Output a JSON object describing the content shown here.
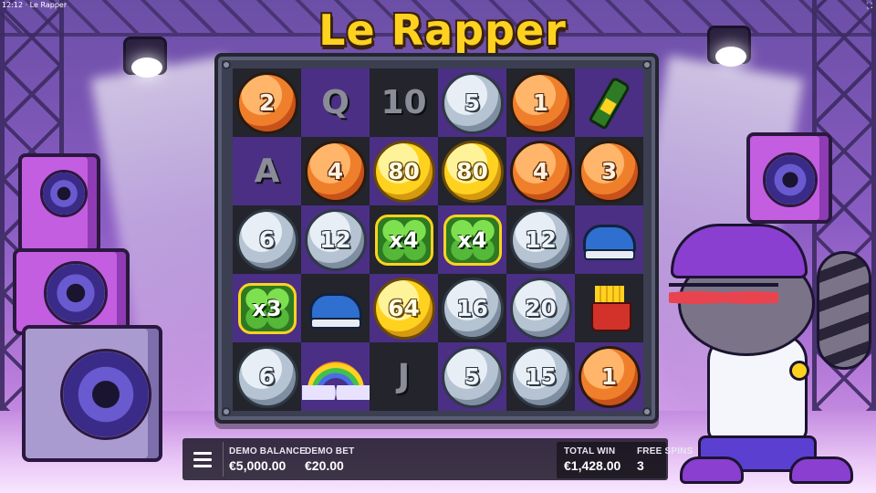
{
  "window": {
    "title": "12:12 · Le Rapper"
  },
  "game": {
    "logo": "Le Rapper"
  },
  "reels": {
    "grid": [
      [
        {
          "kind": "coin",
          "tone": "bronze",
          "label": "2"
        },
        {
          "kind": "letter",
          "label": "Q"
        },
        {
          "kind": "letter",
          "label": "10"
        },
        {
          "kind": "coin",
          "tone": "silver",
          "label": "5"
        },
        {
          "kind": "coin",
          "tone": "bronze",
          "label": "1"
        },
        {
          "kind": "icon",
          "icon": "champagne-bottle-icon"
        }
      ],
      [
        {
          "kind": "letter",
          "label": "A"
        },
        {
          "kind": "coin",
          "tone": "bronze",
          "label": "4"
        },
        {
          "kind": "coin",
          "tone": "gold",
          "label": "80"
        },
        {
          "kind": "coin",
          "tone": "gold",
          "label": "80"
        },
        {
          "kind": "coin",
          "tone": "bronze",
          "label": "4"
        },
        {
          "kind": "coin",
          "tone": "bronze",
          "label": "3"
        }
      ],
      [
        {
          "kind": "coin",
          "tone": "silver",
          "label": "6"
        },
        {
          "kind": "coin",
          "tone": "silver",
          "label": "12"
        },
        {
          "kind": "clover",
          "label": "x4"
        },
        {
          "kind": "clover",
          "label": "x4"
        },
        {
          "kind": "coin",
          "tone": "silver",
          "label": "12"
        },
        {
          "kind": "icon",
          "icon": "sneaker-icon"
        }
      ],
      [
        {
          "kind": "clover",
          "label": "x3"
        },
        {
          "kind": "icon",
          "icon": "sneaker-icon"
        },
        {
          "kind": "coin",
          "tone": "gold",
          "label": "64"
        },
        {
          "kind": "coin",
          "tone": "silver",
          "label": "16"
        },
        {
          "kind": "coin",
          "tone": "silver",
          "label": "20"
        },
        {
          "kind": "icon",
          "icon": "fries-icon"
        }
      ],
      [
        {
          "kind": "coin",
          "tone": "silver",
          "label": "6"
        },
        {
          "kind": "icon",
          "icon": "rainbow-icon"
        },
        {
          "kind": "letter",
          "label": "J"
        },
        {
          "kind": "coin",
          "tone": "silver",
          "label": "5"
        },
        {
          "kind": "coin",
          "tone": "silver",
          "label": "15"
        },
        {
          "kind": "coin",
          "tone": "bronze",
          "label": "1"
        }
      ]
    ]
  },
  "hud": {
    "balance_label": "DEMO BALANCE",
    "balance_value": "€5,000.00",
    "bet_label": "DEMO BET",
    "bet_value": "€20.00",
    "total_win_label": "TOTAL WIN",
    "total_win_value": "€1,428.00",
    "free_spins_label": "FREE SPINS",
    "free_spins_value": "3"
  },
  "colors": {
    "bronze": "#f07f2b",
    "silver": "#b5c3d2",
    "gold": "#ffd21f",
    "purple_cell": "#4a2f84"
  }
}
